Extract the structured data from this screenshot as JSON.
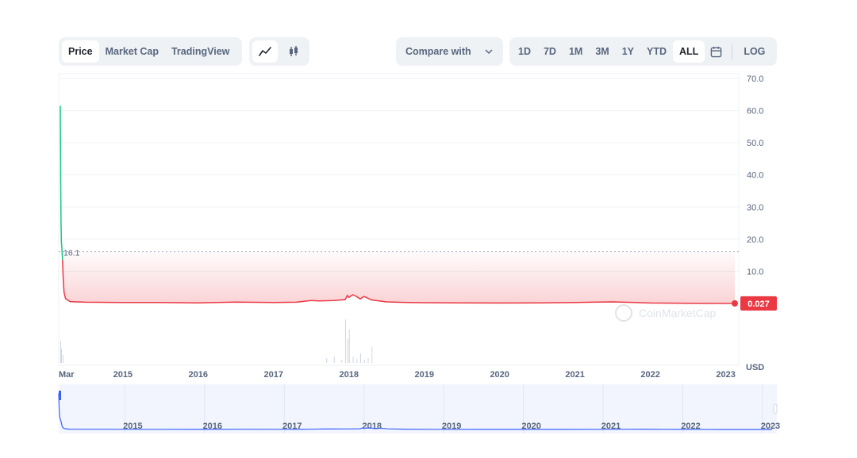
{
  "toolbar": {
    "tabs": [
      {
        "label": "Price",
        "active": true
      },
      {
        "label": "Market Cap",
        "active": false
      },
      {
        "label": "TradingView",
        "active": false
      }
    ],
    "chart_types": [
      {
        "icon": "line-chart-icon",
        "active": true
      },
      {
        "icon": "candlestick-icon",
        "active": false
      }
    ],
    "compare_label": "Compare with",
    "ranges": [
      {
        "label": "1D",
        "active": false
      },
      {
        "label": "7D",
        "active": false
      },
      {
        "label": "1M",
        "active": false
      },
      {
        "label": "3M",
        "active": false
      },
      {
        "label": "1Y",
        "active": false
      },
      {
        "label": "YTD",
        "active": false
      },
      {
        "label": "ALL",
        "active": true
      }
    ],
    "log_label": "LOG"
  },
  "watermark": "CoinMarketCap",
  "chart_data": {
    "type": "line",
    "ylim": [
      0,
      70
    ],
    "y_ticks": [
      "70.0",
      "60.0",
      "50.0",
      "40.0",
      "30.0",
      "20.0",
      "10.0"
    ],
    "y_tick_values": [
      70,
      60,
      50,
      40,
      30,
      20,
      10
    ],
    "x_ticks": [
      "Mar",
      "2015",
      "2016",
      "2017",
      "2018",
      "2019",
      "2020",
      "2021",
      "2022",
      "2023"
    ],
    "x_tick_dates": [
      2014.17,
      2015.0,
      2016.0,
      2017.0,
      2018.0,
      2019.0,
      2020.0,
      2021.0,
      2022.0,
      2023.0
    ],
    "y_unit": "USD",
    "reference_label": "16.1",
    "reference_value": 16.1,
    "current_label": "0.027",
    "current_value": 0.027,
    "colors": {
      "up": "#16c784",
      "down": "#ea3943",
      "navigator": "#3861fb"
    },
    "series": [
      {
        "x": [
          2014.17,
          2014.175,
          2014.18,
          2014.185,
          2014.19,
          2014.2,
          2014.21,
          2014.22,
          2014.24,
          2014.3,
          2014.5,
          2014.8,
          2015.0,
          2015.5,
          2016.0,
          2016.5,
          2017.0,
          2017.3,
          2017.5,
          2017.6,
          2017.8,
          2017.95,
          2017.98,
          2018.0,
          2018.05,
          2018.1,
          2018.15,
          2018.2,
          2018.3,
          2018.5,
          2018.8,
          2019.0,
          2019.5,
          2020.0,
          2020.5,
          2021.0,
          2021.3,
          2021.5,
          2021.8,
          2022.0,
          2022.5,
          2023.0,
          2023.12
        ],
        "values": [
          61.5,
          38,
          25,
          19,
          17.5,
          13.5,
          7,
          3.5,
          1.5,
          0.6,
          0.4,
          0.35,
          0.3,
          0.3,
          0.2,
          0.45,
          0.3,
          0.4,
          0.9,
          0.8,
          0.9,
          1.2,
          2.5,
          1.9,
          2.7,
          2.2,
          1.4,
          2.2,
          1.1,
          0.5,
          0.3,
          0.25,
          0.2,
          0.15,
          0.18,
          0.3,
          0.45,
          0.5,
          0.3,
          0.15,
          0.05,
          0.03,
          0.027
        ]
      }
    ],
    "volume": {
      "x": [
        2014.17,
        2014.18,
        2014.2,
        2017.7,
        2017.8,
        2017.9,
        2017.95,
        2017.98,
        2018.0,
        2018.05,
        2018.1,
        2018.15,
        2018.2,
        2018.25,
        2018.3
      ],
      "values": [
        28,
        18,
        10,
        6,
        8,
        4,
        55,
        30,
        42,
        8,
        5,
        12,
        4,
        6,
        20
      ]
    },
    "navigator_x_ticks": [
      "2015",
      "2016",
      "2017",
      "2018",
      "2019",
      "2020",
      "2021",
      "2022",
      "2023"
    ]
  }
}
